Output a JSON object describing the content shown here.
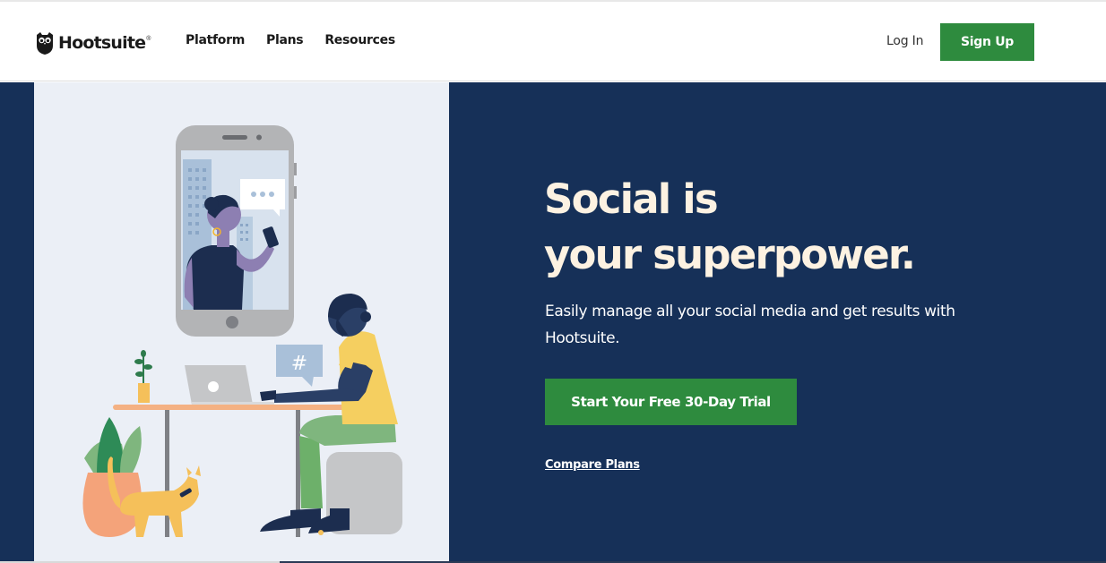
{
  "brand": {
    "name": "Hootsuite",
    "registered_mark": "®",
    "logo_icon": "owl-logo-icon"
  },
  "nav": {
    "items": [
      {
        "label": "Platform"
      },
      {
        "label": "Plans"
      },
      {
        "label": "Resources"
      }
    ]
  },
  "header_actions": {
    "login_label": "Log In",
    "signup_label": "Sign Up"
  },
  "hero": {
    "headline_line1": "Social is",
    "headline_line2": "your superpower.",
    "subtext": "Easily manage all your social media and get results with Hootsuite.",
    "cta_label": "Start Your Free 30-Day Trial",
    "compare_label": "Compare Plans",
    "illustration": {
      "hashtag_bubble_text": "#",
      "chat_bubble_icon": "typing-dots-icon"
    }
  },
  "colors": {
    "hero_background": "#163058",
    "illustration_background": "#ebeff6",
    "primary_green": "#2e8b3e",
    "headline_cream": "#fdf2e2"
  }
}
